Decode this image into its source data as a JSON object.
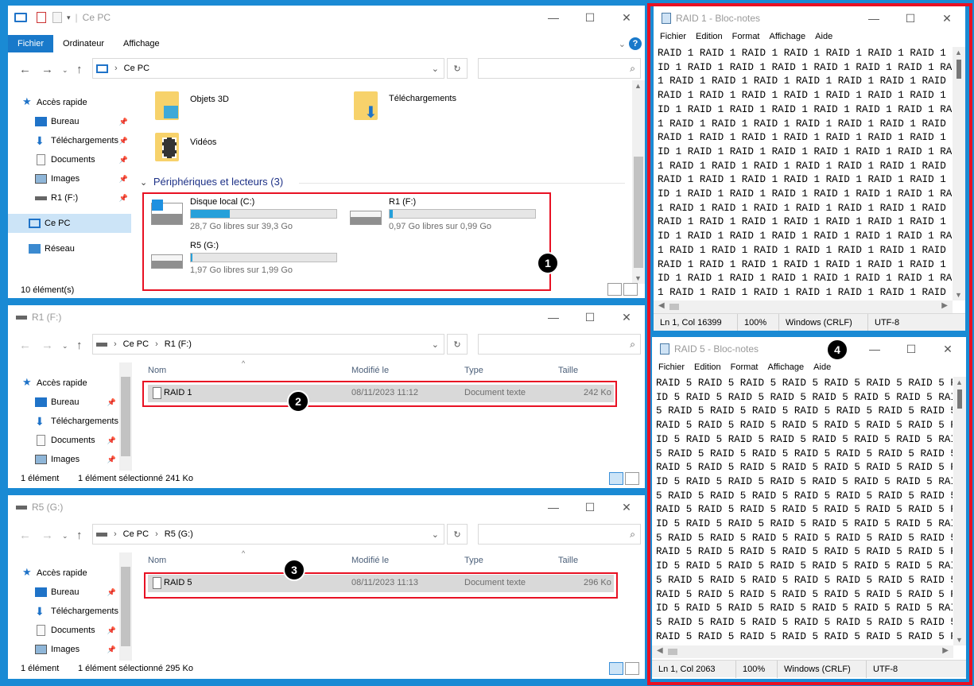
{
  "explorer_main": {
    "title": "Ce PC",
    "ribbon_tabs": [
      "Fichier",
      "Ordinateur",
      "Affichage"
    ],
    "path": [
      "Ce PC"
    ],
    "nav": [
      {
        "label": "Accès rapide",
        "icon": "star-icon"
      },
      {
        "label": "Bureau",
        "icon": "desktop-icon"
      },
      {
        "label": "Téléchargements",
        "icon": "download-icon"
      },
      {
        "label": "Documents",
        "icon": "document-icon"
      },
      {
        "label": "Images",
        "icon": "image-icon"
      },
      {
        "label": "R1 (F:)",
        "icon": "drive-icon"
      },
      {
        "label": "Ce PC",
        "icon": "computer-icon"
      },
      {
        "label": "Réseau",
        "icon": "network-icon"
      }
    ],
    "folders": [
      {
        "label": "Objets 3D",
        "icon": "3d-objects-folder-icon"
      },
      {
        "label": "Téléchargements",
        "icon": "downloads-folder-icon"
      },
      {
        "label": "Vidéos",
        "icon": "videos-folder-icon"
      }
    ],
    "drives_group": "Périphériques et lecteurs (3)",
    "drives": [
      {
        "name": "Disque local (C:)",
        "free": "28,7 Go libres sur 39,3 Go",
        "used_fraction": 0.27,
        "icon": "windows-drive-icon"
      },
      {
        "name": "R1 (F:)",
        "free": "0,97 Go libres sur 0,99 Go",
        "used_fraction": 0.02,
        "icon": "drive-icon"
      },
      {
        "name": "R5 (G:)",
        "free": "1,97 Go libres sur 1,99 Go",
        "used_fraction": 0.01,
        "icon": "drive-icon"
      }
    ],
    "status": "10 élément(s)",
    "badge": "1"
  },
  "explorer_r1": {
    "title": "R1 (F:)",
    "path": [
      "Ce PC",
      "R1 (F:)"
    ],
    "nav": [
      "Accès rapide",
      "Bureau",
      "Téléchargements",
      "Documents",
      "Images"
    ],
    "columns": [
      "Nom",
      "Modifié le",
      "Type",
      "Taille"
    ],
    "file": {
      "name": "RAID 1",
      "modified": "08/11/2023 11:12",
      "type": "Document texte",
      "size": "242 Ko"
    },
    "status_count": "1 élément",
    "status_sel": "1 élément sélectionné 241 Ko",
    "badge": "2"
  },
  "explorer_r5": {
    "title": "R5 (G:)",
    "path": [
      "Ce PC",
      "R5 (G:)"
    ],
    "nav": [
      "Accès rapide",
      "Bureau",
      "Téléchargements",
      "Documents",
      "Images"
    ],
    "columns": [
      "Nom",
      "Modifié le",
      "Type",
      "Taille"
    ],
    "file": {
      "name": "RAID 5",
      "modified": "08/11/2023 11:13",
      "type": "Document texte",
      "size": "296 Ko"
    },
    "status_count": "1 élément",
    "status_sel": "1 élément sélectionné 295 Ko",
    "badge": "3"
  },
  "notepad_raid1": {
    "title": "RAID 1 - Bloc-notes",
    "menu": [
      "Fichier",
      "Edition",
      "Format",
      "Affichage",
      "Aide"
    ],
    "lines": [
      "RAID 1 RAID 1 RAID 1 RAID 1 RAID 1 RAID 1 RAID 1 RA",
      "ID 1 RAID 1 RAID 1 RAID 1 RAID 1 RAID 1 RAID 1 RAID 1",
      "1 RAID 1 RAID 1 RAID 1 RAID 1 RAID 1 RAID 1 RAID 1 RAI",
      "RAID 1 RAID 1 RAID 1 RAID 1 RAID 1 RAID 1 RAID 1 RAID",
      "ID 1 RAID 1 RAID 1 RAID 1 RAID 1 RAID 1 RAID 1 RAID 1",
      "1 RAID 1 RAID 1 RAID 1 RAID 1 RAID 1 RAID 1 RAID 1 RAI",
      "RAID 1 RAID 1 RAID 1 RAID 1 RAID 1 RAID 1 RAID 1 RAID",
      "ID 1 RAID 1 RAID 1 RAID 1 RAID 1 RAID 1 RAID 1 RAID 1",
      "1 RAID 1 RAID 1 RAID 1 RAID 1 RAID 1 RAID 1 RAID 1 RAI",
      "RAID 1 RAID 1 RAID 1 RAID 1 RAID 1 RAID 1 RAID 1 RAID",
      "ID 1 RAID 1 RAID 1 RAID 1 RAID 1 RAID 1 RAID 1 RAID 1",
      "1 RAID 1 RAID 1 RAID 1 RAID 1 RAID 1 RAID 1 RAID 1 RAI",
      "RAID 1 RAID 1 RAID 1 RAID 1 RAID 1 RAID 1 RAID 1 RAID",
      "ID 1 RAID 1 RAID 1 RAID 1 RAID 1 RAID 1 RAID 1 RAID 1",
      "1 RAID 1 RAID 1 RAID 1 RAID 1 RAID 1 RAID 1 RAID 1 RAI",
      "RAID 1 RAID 1 RAID 1 RAID 1 RAID 1 RAID 1 RAID 1 RAID",
      "ID 1 RAID 1 RAID 1 RAID 1 RAID 1 RAID 1 RAID 1 RAID 1",
      "1 RAID 1 RAID 1 RAID 1 RAID 1 RAID 1 RAID 1 RAID 1 RAI"
    ],
    "status": [
      "Ln 1, Col 16399",
      "100%",
      "Windows (CRLF)",
      "UTF-8"
    ]
  },
  "notepad_raid5": {
    "title": "RAID 5 - Bloc-notes",
    "menu": [
      "Fichier",
      "Edition",
      "Format",
      "Affichage",
      "Aide"
    ],
    "lines": [
      "RAID 5 RAID 5 RAID 5 RAID 5 RAID 5 RAID 5 RAID 5 RAID",
      "ID 5 RAID 5 RAID 5 RAID 5 RAID 5 RAID 5 RAID 5 RAID 5",
      "5 RAID 5 RAID 5 RAID 5 RAID 5 RAID 5 RAID 5 RAID 5 RAI",
      "RAID 5 RAID 5 RAID 5 RAID 5 RAID 5 RAID 5 RAID 5 RAID",
      "ID 5 RAID 5 RAID 5 RAID 5 RAID 5 RAID 5 RAID 5 RAID 5",
      "5 RAID 5 RAID 5 RAID 5 RAID 5 RAID 5 RAID 5 RAID 5 RAI",
      "RAID 5 RAID 5 RAID 5 RAID 5 RAID 5 RAID 5 RAID 5 RAID",
      "ID 5 RAID 5 RAID 5 RAID 5 RAID 5 RAID 5 RAID 5 RAID 5",
      "5 RAID 5 RAID 5 RAID 5 RAID 5 RAID 5 RAID 5 RAID 5 RAI",
      "RAID 5 RAID 5 RAID 5 RAID 5 RAID 5 RAID 5 RAID 5 RAID",
      "ID 5 RAID 5 RAID 5 RAID 5 RAID 5 RAID 5 RAID 5 RAID 5",
      "5 RAID 5 RAID 5 RAID 5 RAID 5 RAID 5 RAID 5 RAID 5 RAI",
      "RAID 5 RAID 5 RAID 5 RAID 5 RAID 5 RAID 5 RAID 5 RAID",
      "ID 5 RAID 5 RAID 5 RAID 5 RAID 5 RAID 5 RAID 5 RAID 5",
      "5 RAID 5 RAID 5 RAID 5 RAID 5 RAID 5 RAID 5 RAID 5 RAI",
      "RAID 5 RAID 5 RAID 5 RAID 5 RAID 5 RAID 5 RAID 5 RAID",
      "ID 5 RAID 5 RAID 5 RAID 5 RAID 5 RAID 5 RAID 5 RAID 5",
      "5 RAID 5 RAID 5 RAID 5 RAID 5 RAID 5 RAID 5 RAID 5 RAI",
      "RAID 5 RAID 5 RAID 5 RAID 5 RAID 5 RAID 5 RAID 5 RAID"
    ],
    "status": [
      "Ln 1, Col 2063",
      "100%",
      "Windows (CRLF)",
      "UTF-8"
    ],
    "badge": "4"
  },
  "colors": {
    "accent": "#1979ca",
    "highlight": "#e81123",
    "taskbar": "#1a8ad4"
  }
}
